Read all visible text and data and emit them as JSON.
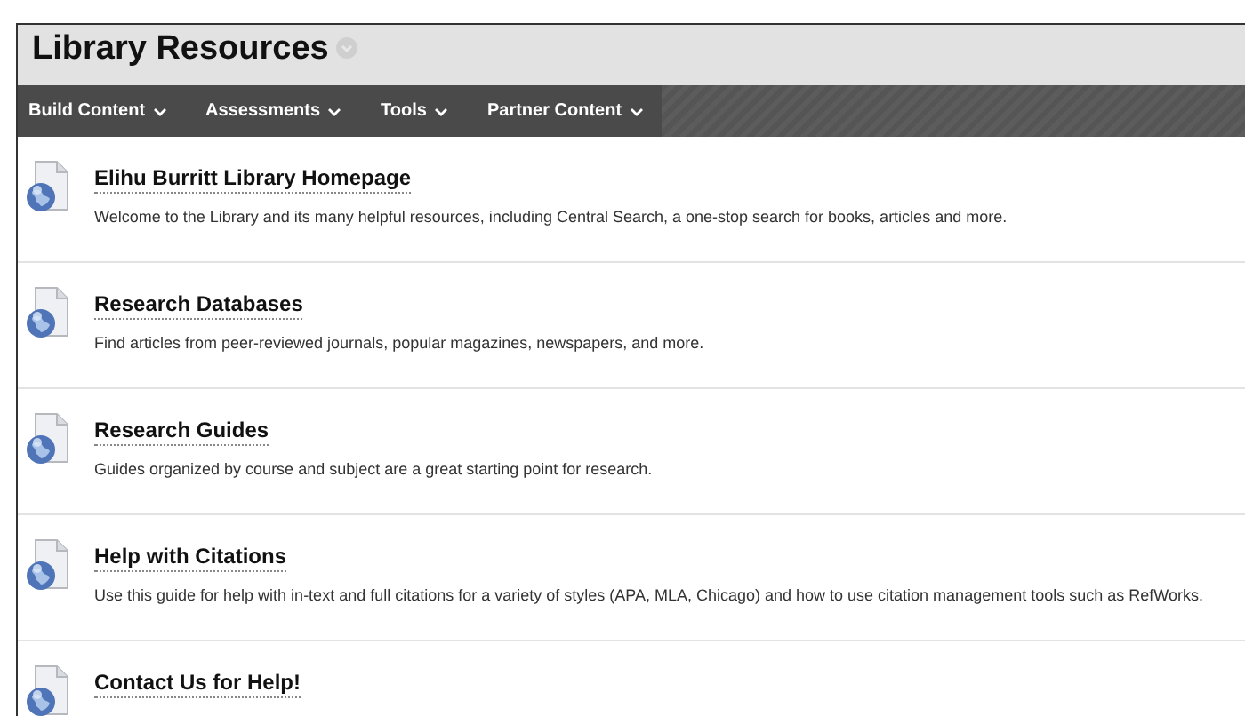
{
  "page_title": "Library Resources",
  "menu": [
    {
      "label": "Build Content"
    },
    {
      "label": "Assessments"
    },
    {
      "label": "Tools"
    },
    {
      "label": "Partner Content"
    }
  ],
  "items": [
    {
      "title": "Elihu Burritt Library Homepage",
      "description": "Welcome to the Library and its many helpful resources, including Central Search, a one-stop search for books, articles and more."
    },
    {
      "title": "Research Databases",
      "description": "Find articles from peer-reviewed journals, popular magazines, newspapers, and more."
    },
    {
      "title": "Research Guides",
      "description": "Guides organized by course and subject are a great starting point for research."
    },
    {
      "title": "Help with Citations",
      "description": "Use this guide for help with in-text and full citations for a variety of styles (APA, MLA, Chicago) and how to use citation management tools such as RefWorks."
    },
    {
      "title": "Contact Us for Help!"
    }
  ]
}
